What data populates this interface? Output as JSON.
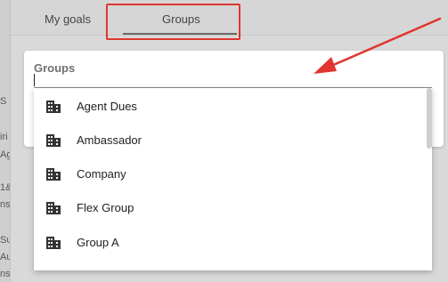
{
  "tabs": [
    {
      "label": "My goals"
    },
    {
      "label": "Groups"
    }
  ],
  "card": {
    "label": "Groups"
  },
  "dropdown": {
    "options": [
      {
        "label": "Agent Dues",
        "icon": "building-icon"
      },
      {
        "label": "Ambassador",
        "icon": "building-icon"
      },
      {
        "label": "Company",
        "icon": "building-icon"
      },
      {
        "label": "Flex Group",
        "icon": "building-icon"
      },
      {
        "label": "Group A",
        "icon": "building-icon"
      }
    ]
  },
  "background_fragments": [
    "S",
    "iri",
    "Ag",
    "1&",
    "ns",
    "Su",
    "Au",
    "ns"
  ],
  "colors": {
    "annotation": "#e03530"
  }
}
